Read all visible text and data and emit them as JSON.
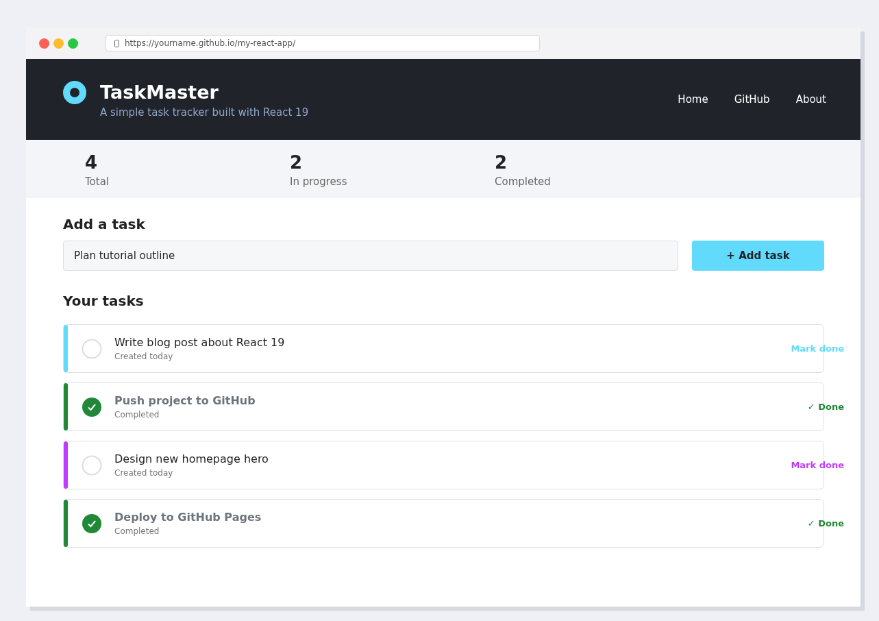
{
  "browser": {
    "url": "https://yourname.github.io/my-react-app/"
  },
  "header": {
    "title": "TaskMaster",
    "subtitle": "A simple task tracker built with React 19",
    "nav": [
      "Home",
      "GitHub",
      "About"
    ]
  },
  "stats": [
    {
      "value": "4",
      "label": "Total"
    },
    {
      "value": "2",
      "label": "In progress"
    },
    {
      "value": "2",
      "label": "Completed"
    }
  ],
  "add_task": {
    "heading": "Add a task",
    "value": "Plan tutorial outline",
    "button": "+ Add task"
  },
  "tasks_heading": "Your tasks",
  "tasks": [
    {
      "title": "Write blog post about React 19",
      "meta": "Created today",
      "action": "Mark done",
      "checked": false,
      "color": "#61dafb"
    },
    {
      "title": "Push project to GitHub",
      "meta": "Completed",
      "action": "✓ Done",
      "checked": true,
      "color": "#218838"
    },
    {
      "title": "Design new homepage hero",
      "meta": "Created today",
      "action": "Mark done",
      "checked": false,
      "color": "#c13cff"
    },
    {
      "title": "Deploy to GitHub Pages",
      "meta": "Completed",
      "action": "✓ Done",
      "checked": true,
      "color": "#218838"
    }
  ]
}
